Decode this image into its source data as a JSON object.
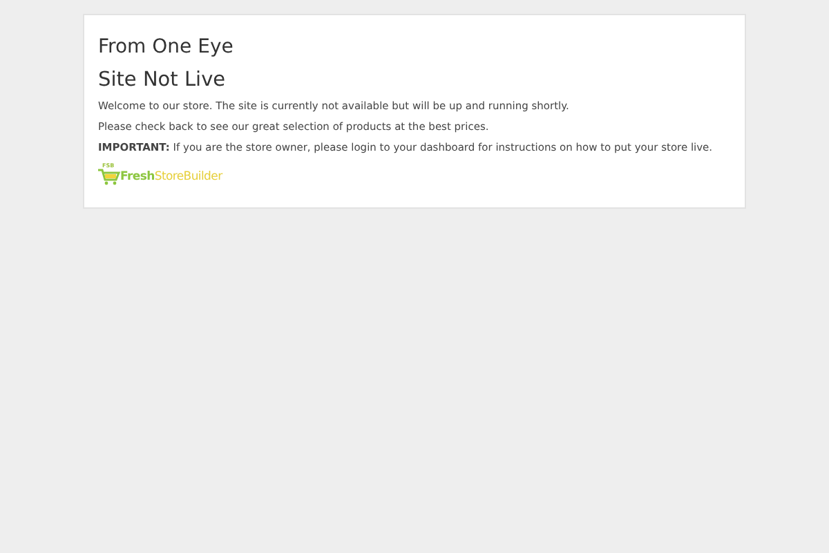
{
  "site_title": "From One Eye",
  "heading": "Site Not Live",
  "paragraphs": [
    "Welcome to our store. The site is currently not available but will be up and running shortly.",
    "Please check back to see our great selection of products at the best prices.",
    "**IMPORTANT:** If you are the store owner, please login to your dashboard for instructions on how to put your store live."
  ],
  "logo": {
    "mark": "FSB",
    "word_1": "Fresh",
    "word_2": "StoreBuilder"
  }
}
